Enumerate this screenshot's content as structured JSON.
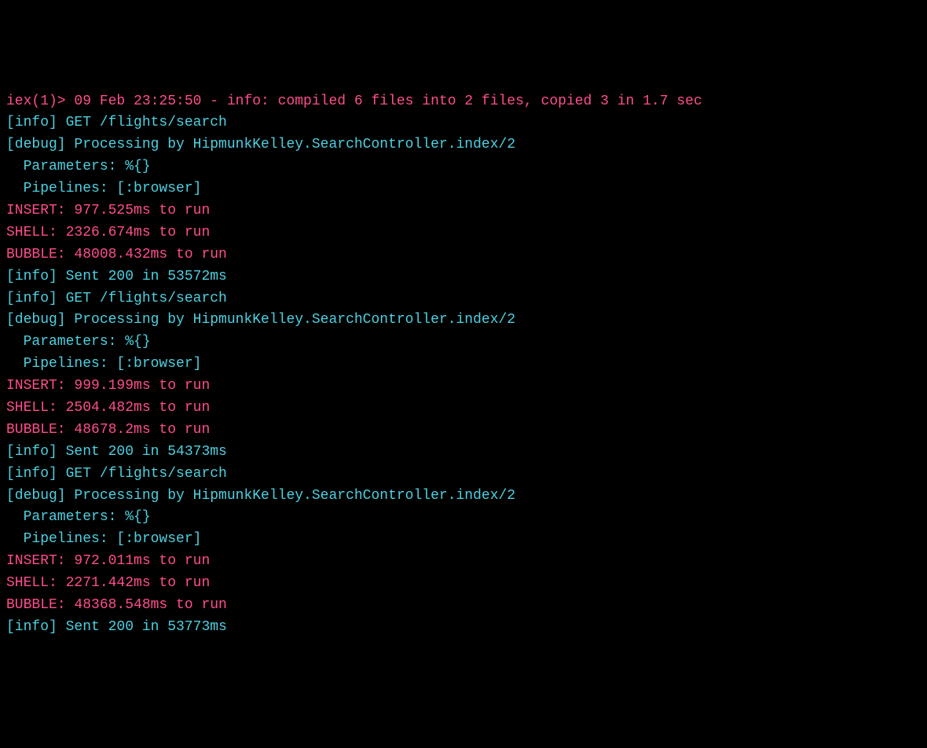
{
  "lines": [
    {
      "c": "pink",
      "t": "iex(1)> 09 Feb 23:25:50 - info: compiled 6 files into 2 files, copied 3 in 1.7 sec"
    },
    {
      "c": "cyan",
      "t": "[info] GET /flights/search"
    },
    {
      "c": "cyan",
      "t": "[debug] Processing by HipmunkKelley.SearchController.index/2"
    },
    {
      "c": "cyan",
      "t": "  Parameters: %{}"
    },
    {
      "c": "cyan",
      "t": "  Pipelines: [:browser]"
    },
    {
      "c": "pink",
      "t": "INSERT: 977.525ms to run"
    },
    {
      "c": "pink",
      "t": "SHELL: 2326.674ms to run"
    },
    {
      "c": "pink",
      "t": "BUBBLE: 48008.432ms to run"
    },
    {
      "c": "cyan",
      "t": "[info] Sent 200 in 53572ms"
    },
    {
      "c": "cyan",
      "t": "[info] GET /flights/search"
    },
    {
      "c": "cyan",
      "t": "[debug] Processing by HipmunkKelley.SearchController.index/2"
    },
    {
      "c": "cyan",
      "t": "  Parameters: %{}"
    },
    {
      "c": "cyan",
      "t": "  Pipelines: [:browser]"
    },
    {
      "c": "pink",
      "t": "INSERT: 999.199ms to run"
    },
    {
      "c": "pink",
      "t": "SHELL: 2504.482ms to run"
    },
    {
      "c": "pink",
      "t": "BUBBLE: 48678.2ms to run"
    },
    {
      "c": "cyan",
      "t": "[info] Sent 200 in 54373ms"
    },
    {
      "c": "cyan",
      "t": "[info] GET /flights/search"
    },
    {
      "c": "cyan",
      "t": "[debug] Processing by HipmunkKelley.SearchController.index/2"
    },
    {
      "c": "cyan",
      "t": "  Parameters: %{}"
    },
    {
      "c": "cyan",
      "t": "  Pipelines: [:browser]"
    },
    {
      "c": "pink",
      "t": "INSERT: 972.011ms to run"
    },
    {
      "c": "pink",
      "t": "SHELL: 2271.442ms to run"
    },
    {
      "c": "pink",
      "t": "BUBBLE: 48368.548ms to run"
    },
    {
      "c": "cyan",
      "t": "[info] Sent 200 in 53773ms"
    }
  ]
}
